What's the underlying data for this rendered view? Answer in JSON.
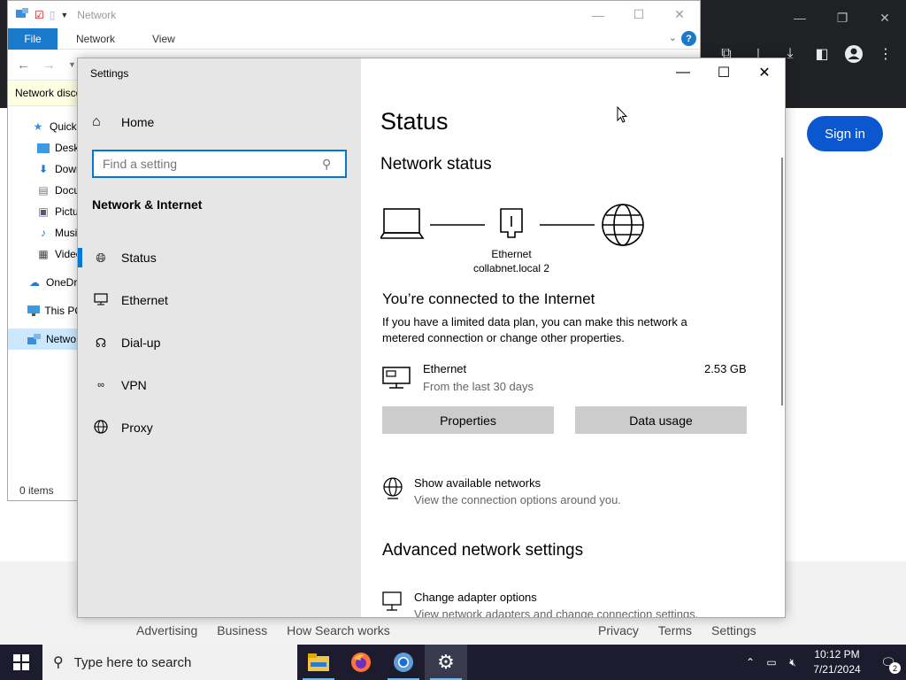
{
  "browser": {
    "signin_label": "Sign in",
    "footer_left": [
      "Advertising",
      "Business",
      "How Search works"
    ],
    "footer_right": [
      "Privacy",
      "Terms",
      "Settings"
    ]
  },
  "explorer": {
    "title": "Network",
    "tabs": [
      "File",
      "Network",
      "View"
    ],
    "help": "?",
    "infobar": "Network disco",
    "nav": [
      {
        "label": "Quick",
        "icon": "star-icon"
      },
      {
        "label": "Deskt",
        "icon": "desktop-folder-icon"
      },
      {
        "label": "Down",
        "icon": "download-arrow-icon"
      },
      {
        "label": "Docu",
        "icon": "document-icon"
      },
      {
        "label": "Pictu",
        "icon": "pictures-icon"
      },
      {
        "label": "Musi",
        "icon": "music-note-icon"
      },
      {
        "label": "Video",
        "icon": "video-icon"
      },
      {
        "label": "OneDr",
        "icon": "cloud-icon"
      },
      {
        "label": "This PC",
        "icon": "computer-icon"
      },
      {
        "label": "Netwo",
        "icon": "network-icon"
      }
    ],
    "status": "0 items"
  },
  "settings": {
    "window_title": "Settings",
    "home_label": "Home",
    "search_placeholder": "Find a setting",
    "section_title": "Network & Internet",
    "nav": [
      {
        "label": "Status",
        "icon": "status-globe-icon"
      },
      {
        "label": "Ethernet",
        "icon": "ethernet-monitor-icon"
      },
      {
        "label": "Dial-up",
        "icon": "dial-up-icon"
      },
      {
        "label": "VPN",
        "icon": "vpn-icon"
      },
      {
        "label": "Proxy",
        "icon": "proxy-globe-icon"
      }
    ],
    "page_title": "Status",
    "network_status_heading": "Network status",
    "adapter_name": "Ethernet",
    "network_name": "collabnet.local 2",
    "connected_heading": "You’re connected to the Internet",
    "connected_desc_1": "If you have a limited data plan, you can make this network a",
    "connected_desc_2": "metered connection or change other properties.",
    "usage_name": "Ethernet",
    "usage_sub": "From the last 30 days",
    "usage_amount": "2.53 GB",
    "properties_button": "Properties",
    "data_usage_button": "Data usage",
    "show_networks_title": "Show available networks",
    "show_networks_sub": "View the connection options around you.",
    "advanced_heading": "Advanced network settings",
    "change_adapter_title": "Change adapter options",
    "change_adapter_sub": "View network adapters and change connection settings."
  },
  "taskbar": {
    "search_placeholder": "Type here to search",
    "time": "10:12 PM",
    "date": "7/21/2024",
    "notification_count": "2"
  }
}
